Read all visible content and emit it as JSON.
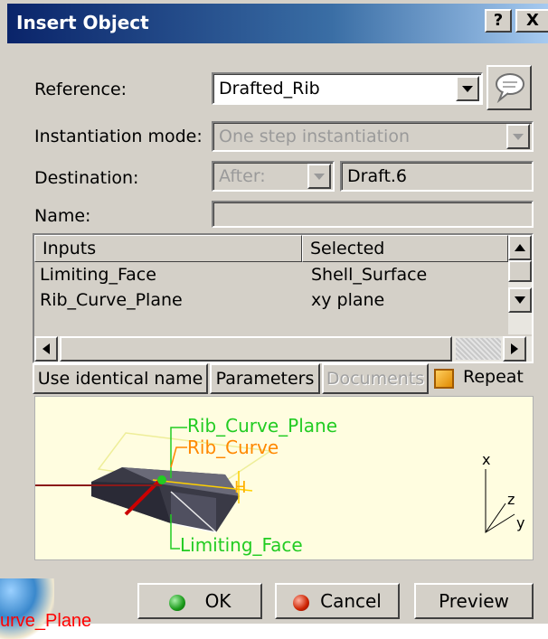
{
  "window": {
    "title": "Insert Object",
    "help_label": "?",
    "close_label": "X"
  },
  "form": {
    "reference_label": "Reference:",
    "reference_value": "Drafted_Rib",
    "instantiation_label": "Instantiation mode:",
    "instantiation_value": "One step instantiation",
    "destination_label": "Destination:",
    "destination_position": "After:",
    "destination_value": "Draft.6",
    "name_label": "Name:",
    "name_value": ""
  },
  "table": {
    "columns": [
      "Inputs",
      "Selected"
    ],
    "rows": [
      {
        "input": "Limiting_Face",
        "selected": "Shell_Surface"
      },
      {
        "input": "Rib_Curve_Plane",
        "selected": "xy plane"
      }
    ]
  },
  "buttons": {
    "use_identical_name": "Use identical name",
    "parameters": "Parameters",
    "documents": "Documents",
    "repeat": "Repeat",
    "ok": "OK",
    "cancel": "Cancel",
    "preview": "Preview"
  },
  "preview": {
    "labels": {
      "rib_curve_plane": "Rib_Curve_Plane",
      "rib_curve": "Rib_Curve",
      "h": "H",
      "limiting_face": "Limiting_Face",
      "axis_x": "x",
      "axis_y": "y",
      "axis_z": "z"
    }
  },
  "overlay": {
    "caption": "urve_Plane"
  },
  "colors": {
    "title_start": "#0a246a",
    "title_end": "#a6caf0",
    "dialog_bg": "#d4d0c8",
    "green_label": "#22cc22",
    "orange_label": "#ff8800",
    "ok_dot": "#1a9a1a",
    "cancel_dot": "#cc2200",
    "caption": "#ff0000"
  }
}
